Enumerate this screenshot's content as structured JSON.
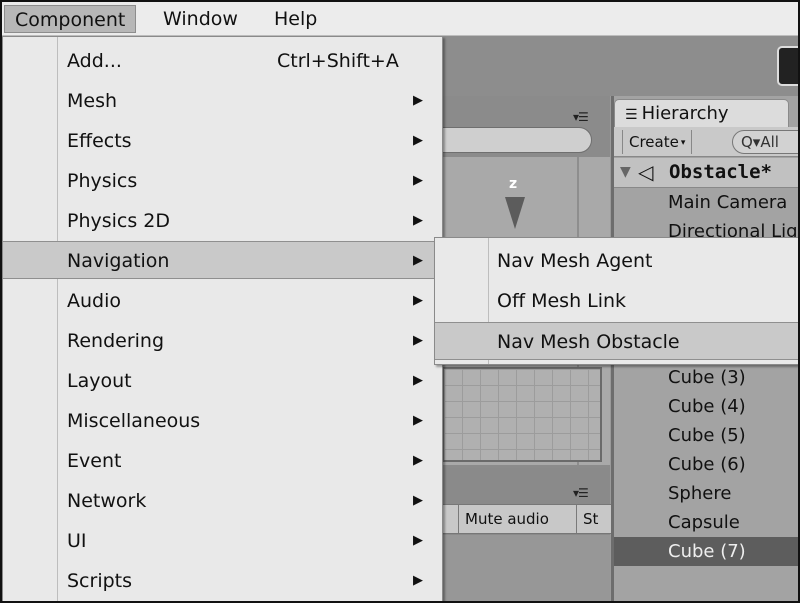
{
  "menubar": {
    "items": [
      {
        "label": "Component",
        "active": true
      },
      {
        "label": "Window",
        "active": false
      },
      {
        "label": "Help",
        "active": false
      }
    ]
  },
  "component_menu": {
    "items": [
      {
        "label": "Add...",
        "shortcut": "Ctrl+Shift+A",
        "has_submenu": false
      },
      {
        "label": "Mesh",
        "has_submenu": true
      },
      {
        "label": "Effects",
        "has_submenu": true
      },
      {
        "label": "Physics",
        "has_submenu": true
      },
      {
        "label": "Physics 2D",
        "has_submenu": true
      },
      {
        "label": "Navigation",
        "has_submenu": true,
        "highlighted": true
      },
      {
        "label": "Audio",
        "has_submenu": true
      },
      {
        "label": "Rendering",
        "has_submenu": true
      },
      {
        "label": "Layout",
        "has_submenu": true
      },
      {
        "label": "Miscellaneous",
        "has_submenu": true
      },
      {
        "label": "Event",
        "has_submenu": true
      },
      {
        "label": "Network",
        "has_submenu": true
      },
      {
        "label": "UI",
        "has_submenu": true
      },
      {
        "label": "Scripts",
        "has_submenu": true
      }
    ],
    "arrow_glyph": "▶"
  },
  "navigation_submenu": {
    "items": [
      {
        "label": "Nav Mesh Agent"
      },
      {
        "label": "Off Mesh Link"
      },
      {
        "label": "Nav Mesh Obstacle",
        "highlighted": true
      }
    ]
  },
  "scene": {
    "gizmo_axis_label": "z",
    "panel_menu_glyph": "▾☰"
  },
  "bottom_panel": {
    "tabs": [
      "Mute audio",
      "St"
    ],
    "panel_menu_glyph": "▾☰"
  },
  "hierarchy": {
    "tab_icon": "☰",
    "tab_label": "Hierarchy",
    "create_label": "Create",
    "create_caret": "▾",
    "search_value": "Q▾All",
    "scene_expand_glyph": "▼",
    "scene_icon_glyph": "◁",
    "scene_name": "Obstacle*",
    "items": [
      {
        "label": "Main Camera",
        "selected": false
      },
      {
        "label": "Directional Light",
        "selected": false
      },
      {
        "label": "Cube (3)",
        "selected": false
      },
      {
        "label": "Cube (4)",
        "selected": false
      },
      {
        "label": "Cube (5)",
        "selected": false
      },
      {
        "label": "Cube (6)",
        "selected": false
      },
      {
        "label": "Sphere",
        "selected": false
      },
      {
        "label": "Capsule",
        "selected": false
      },
      {
        "label": "Cube (7)",
        "selected": true
      }
    ]
  }
}
